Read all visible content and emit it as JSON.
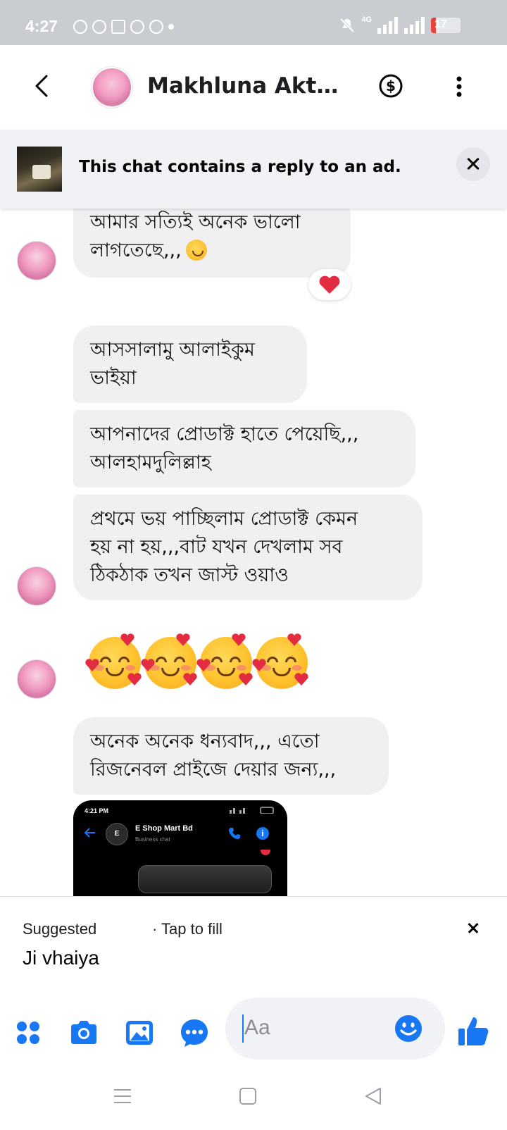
{
  "status_bar": {
    "time": "4:27",
    "network": "4G",
    "battery_level": "17",
    "battery_fraction": 0.17
  },
  "header": {
    "contact_name": "Makhluna Akt…"
  },
  "ad_banner": {
    "text": "This chat contains a reply to an ad."
  },
  "messages": [
    {
      "lines": [
        "আমার সত্যিই অনেক ভালো",
        "লাগতেছে,,,"
      ],
      "reaction": "❤️"
    },
    {
      "lines": [
        "আসসালামু আলাইকুম",
        "ভাইয়া"
      ]
    },
    {
      "lines": [
        "আপনাদের প্রোডাক্ট হাতে পেয়েছি,,,",
        "আলহামদুলিল্লাহ"
      ]
    },
    {
      "lines": [
        "প্রথমে ভয় পাচ্ছিলাম প্রোডাক্ট কেমন",
        "হয় না হয়,,,বাট যখন দেখলাম সব",
        "ঠিকঠাক তখন জাস্ট ওয়াও"
      ]
    },
    {
      "emoji_count": 4,
      "emoji": "smiling-face-with-hearts"
    },
    {
      "lines": [
        "অনেক অনেক ধন্যবাদ,,, এতো",
        "রিজনেবল প্রাইজে দেয়ার জন্য,,,"
      ]
    }
  ],
  "attachment": {
    "time": "4:21 PM",
    "business_name": "E Shop Mart Bd",
    "business_subtitle": "Business chat",
    "logo_letter": "E",
    "info_glyph": "i"
  },
  "suggestion": {
    "label": "Suggested",
    "hint": "· Tap to fill",
    "text": "Ji vhaiya"
  },
  "composer": {
    "placeholder": "Aa"
  },
  "colors": {
    "accent": "#1877f2",
    "bubble": "#f0f0f3",
    "status_bar": "#c9ccd1",
    "heart": "#e22c41"
  }
}
